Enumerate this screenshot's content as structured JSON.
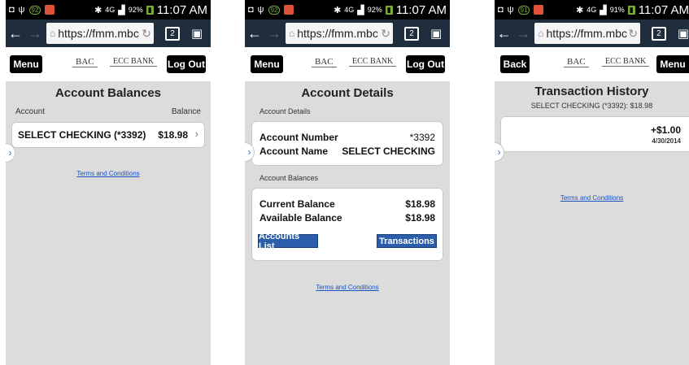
{
  "status": {
    "time": "11:07 AM",
    "battery_1": "92%",
    "battery_2": "92%",
    "battery_3": "91%",
    "signal": "4G",
    "badge_1": "92",
    "badge_2": "92",
    "badge_3": "91"
  },
  "browser": {
    "url": "https://fmm.mbc",
    "tab_count": "2"
  },
  "logos": {
    "bac": "BAC",
    "ecc": "ECC BANK"
  },
  "screen1": {
    "menu_label": "Menu",
    "logout_label": "Log Out",
    "title": "Account Balances",
    "col_account": "Account",
    "col_balance": "Balance",
    "account_name": "SELECT CHECKING (*3392)",
    "account_balance": "$18.98",
    "terms": "Terms and Conditions"
  },
  "screen2": {
    "menu_label": "Menu",
    "logout_label": "Log Out",
    "title": "Account Details",
    "section_details": "Account Details",
    "label_number": "Account Number",
    "value_number": "*3392",
    "label_name": "Account Name",
    "value_name": "SELECT CHECKING",
    "section_balances": "Account Balances",
    "label_current": "Current Balance",
    "value_current": "$18.98",
    "label_available": "Available Balance",
    "value_available": "$18.98",
    "accounts_list_label": "Accounts List",
    "transactions_label": "Transactions",
    "terms": "Terms and Conditions"
  },
  "screen3": {
    "back_label": "Back",
    "menu_label": "Menu",
    "title": "Transaction History",
    "subtitle": "SELECT CHECKING (*3392): $18.98",
    "txn_amount": "+$1.00",
    "txn_date": "4/30/2014",
    "terms": "Terms and Conditions"
  },
  "colors": {
    "accent_blue": "#2a5eaa",
    "link_blue": "#1b53c4",
    "browser_bar": "#1f2d3d"
  }
}
